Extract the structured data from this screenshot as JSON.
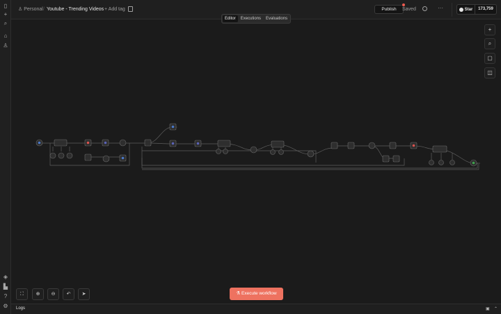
{
  "rail": {
    "top_icons": [
      "sidebar-toggle-icon",
      "plus-icon",
      "search-icon",
      "home-icon",
      "user-icon"
    ],
    "bottom_icons": [
      "cube-icon",
      "chart-icon",
      "help-icon",
      "settings-icon"
    ]
  },
  "header": {
    "breadcrumb_project": "Personal",
    "workflow_title": "Youtube - Trending Videos",
    "add_tag": "+ Add tag",
    "publish": "Publish",
    "saved": "Saved",
    "more": "···",
    "github_star": "Star",
    "github_count": "173,759"
  },
  "tabs": [
    {
      "label": "Editor",
      "active": true
    },
    {
      "label": "Executions",
      "active": false
    },
    {
      "label": "Evaluations",
      "active": false
    }
  ],
  "right_tools": [
    "plus-icon",
    "search-icon",
    "sticky-note-icon",
    "panel-icon"
  ],
  "controls": [
    "fit-view-icon",
    "zoom-in-icon",
    "zoom-out-icon",
    "undo-icon",
    "pointer-icon"
  ],
  "execute_button": "Execute workflow",
  "logs": {
    "label": "Logs"
  },
  "colors": {
    "accent": "#ee7260",
    "canvas_bg": "#1b1b1b",
    "node_bg": "#2e2e2e",
    "trigger": "#4a78c8",
    "node_red": "#d9534f",
    "node_indigo": "#5b63b7",
    "node_green": "#3fa34d"
  }
}
